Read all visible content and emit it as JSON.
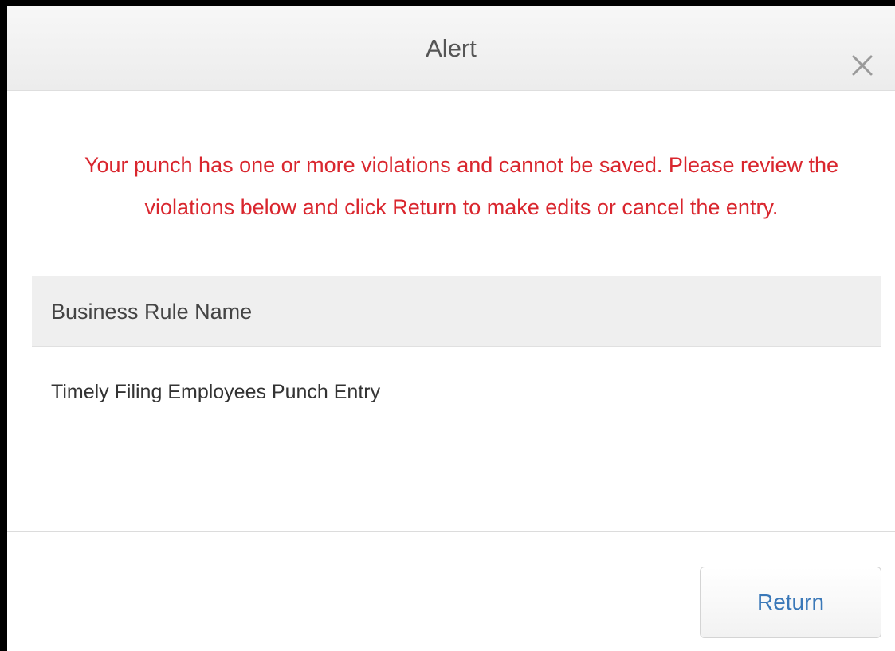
{
  "dialog": {
    "title": "Alert",
    "close_icon": "close-icon",
    "message": "Your punch has one or more violations and cannot be saved. Please review the violations below and click Return to make edits or cancel the entry.",
    "table": {
      "headers": [
        "Business Rule Name"
      ],
      "rows": [
        [
          "Timely Filing Employees Punch Entry"
        ]
      ]
    },
    "return_label": "Return"
  },
  "colors": {
    "message_text": "#d9262e",
    "button_text": "#3a78b8",
    "header_bg": "#efefef"
  }
}
